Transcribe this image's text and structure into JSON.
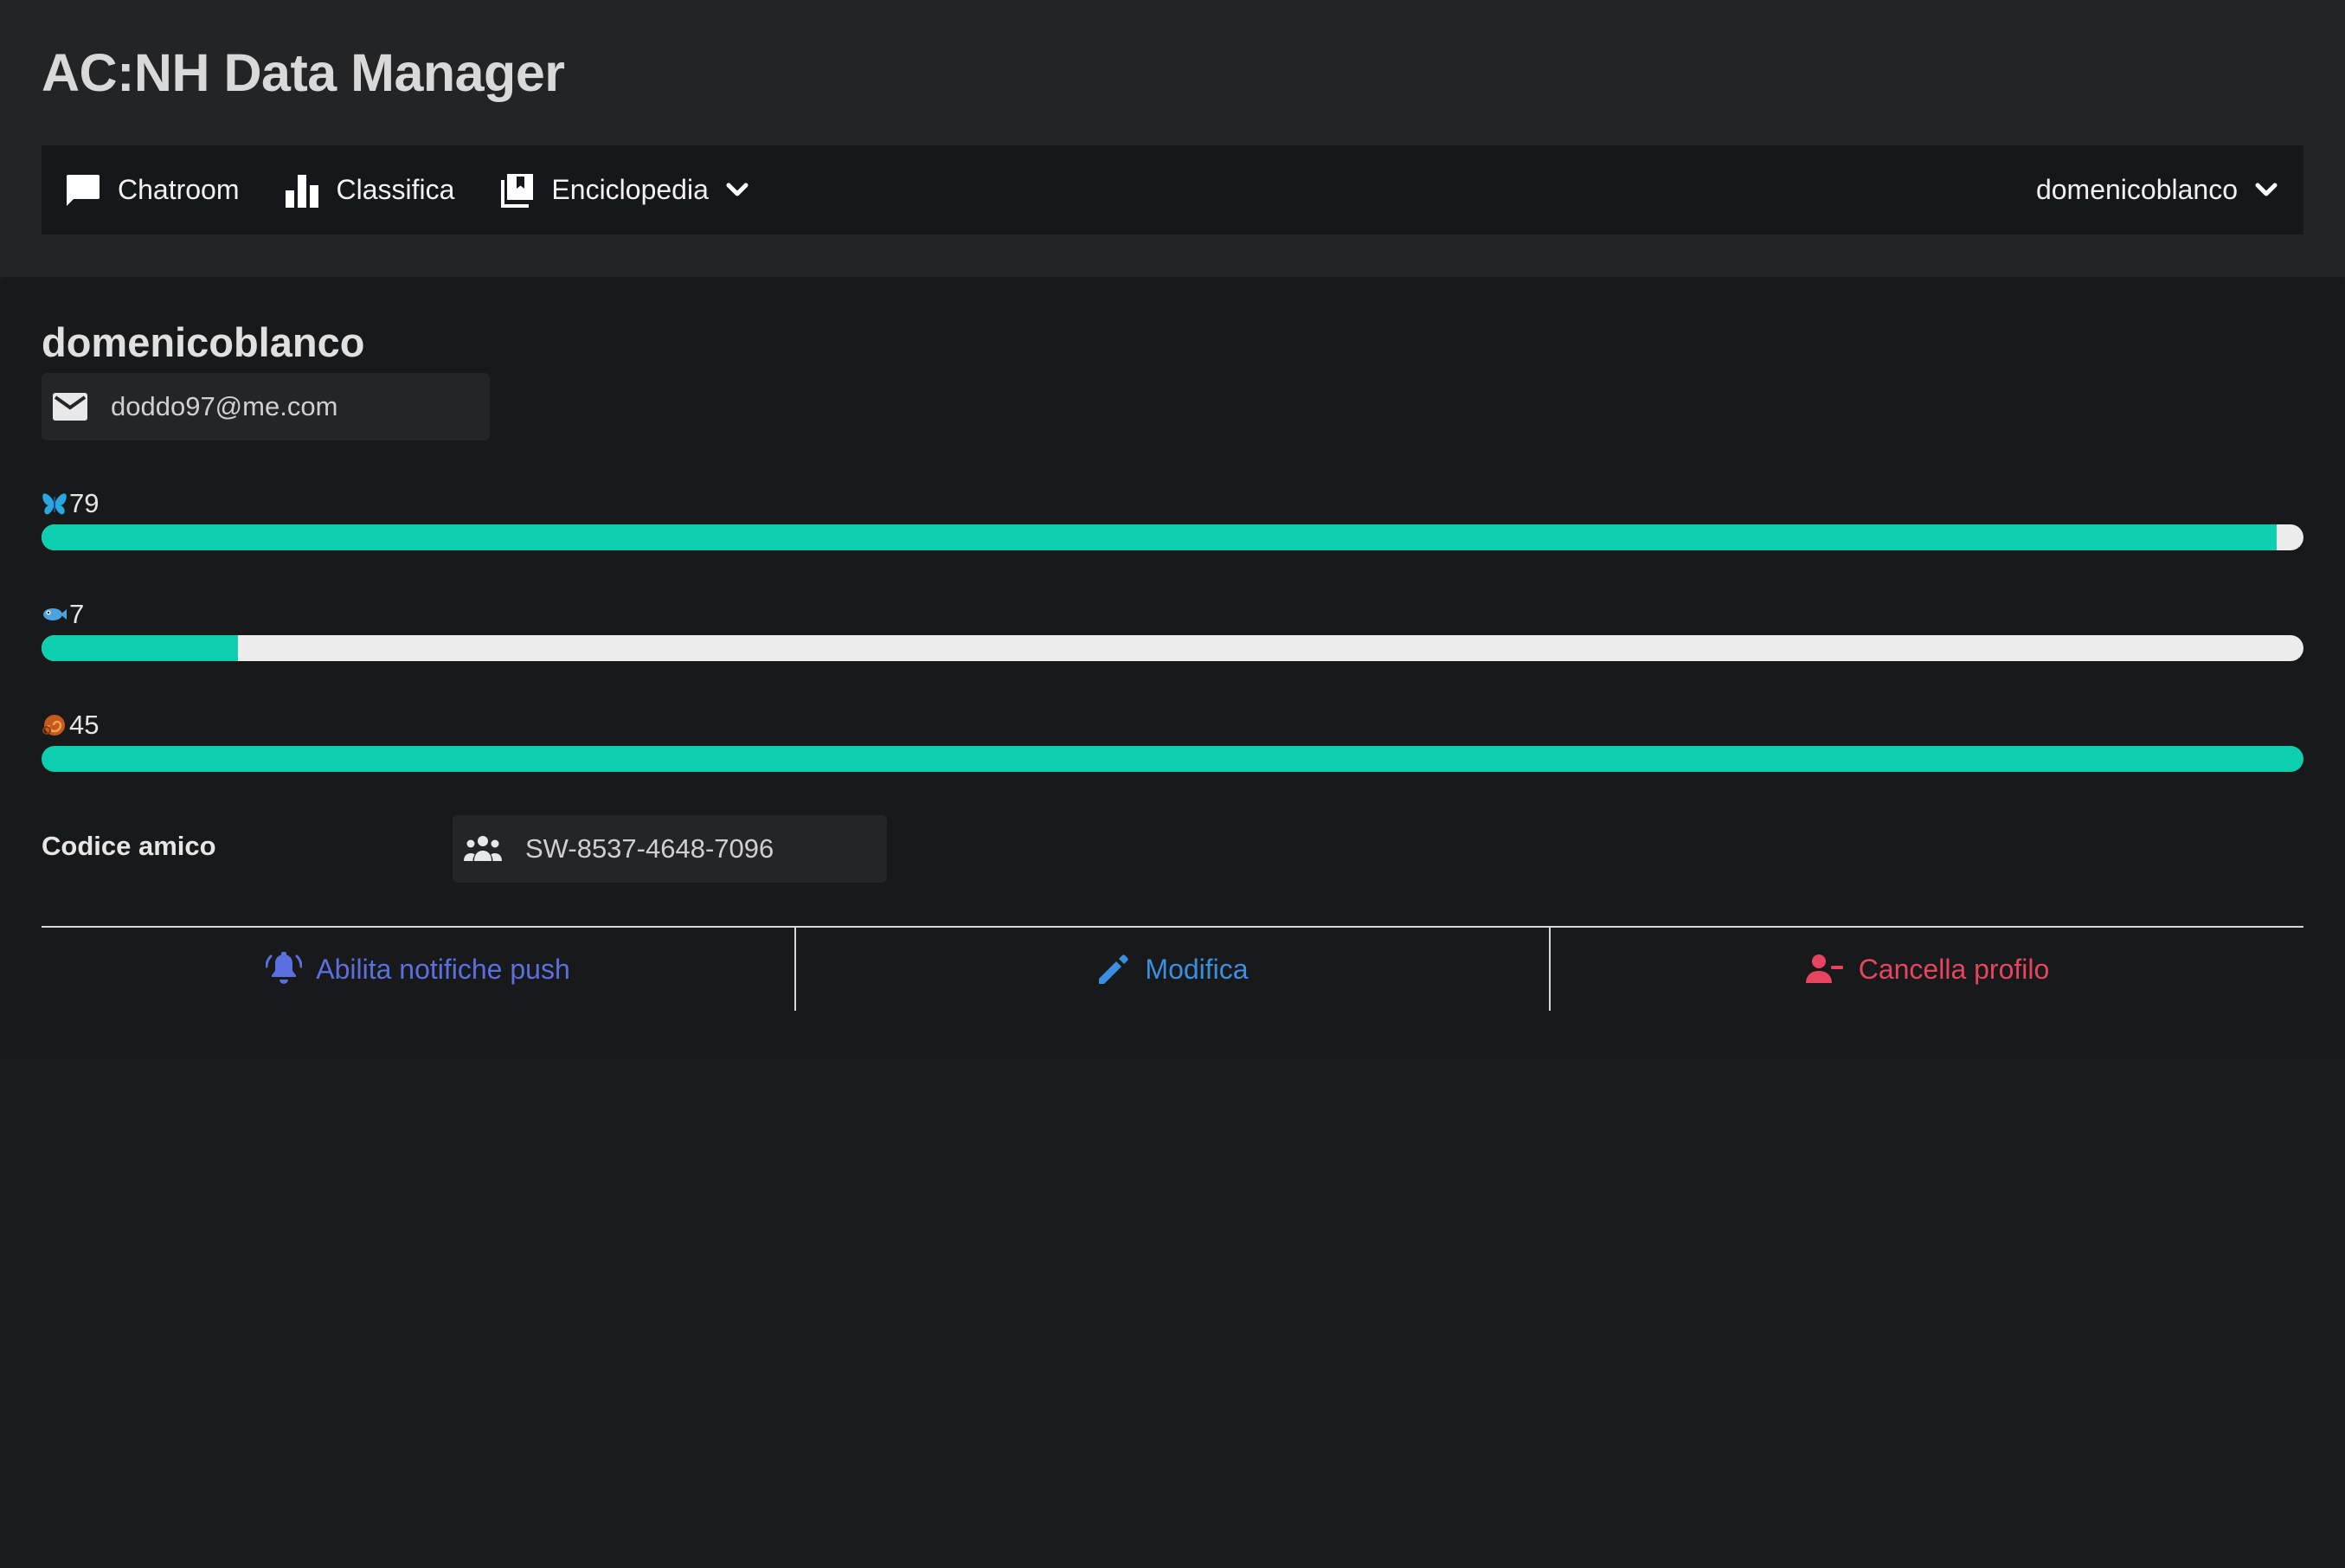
{
  "app": {
    "title": "AC:NH Data Manager"
  },
  "nav": {
    "items": [
      {
        "label": "Chatroom",
        "icon": "chat-bubble-icon"
      },
      {
        "label": "Classifica",
        "icon": "bar-chart-icon"
      },
      {
        "label": "Enciclopedia",
        "icon": "library-icon",
        "has_dropdown": true
      }
    ],
    "user_menu": {
      "label": "domenicoblanco",
      "has_dropdown": true
    }
  },
  "profile": {
    "username": "domenicoblanco",
    "email": "doddo97@me.com",
    "stats": [
      {
        "emoji": "butterfly",
        "value": "79",
        "progress": 0.988
      },
      {
        "emoji": "fish",
        "value": "7",
        "progress": 0.087
      },
      {
        "emoji": "fossil",
        "value": "45",
        "progress": 1.0
      }
    ],
    "friend_code_label": "Codice amico",
    "friend_code": "SW-8537-4648-7096"
  },
  "actions": {
    "notifications_label": "Abilita notifiche push",
    "edit_label": "Modifica",
    "delete_label": "Cancella profilo"
  },
  "colors": {
    "progress_fill": "#0ccfb0",
    "progress_track": "#ececec",
    "notify": "#5b6fe0",
    "edit": "#3b8fe0",
    "delete": "#e64560"
  }
}
